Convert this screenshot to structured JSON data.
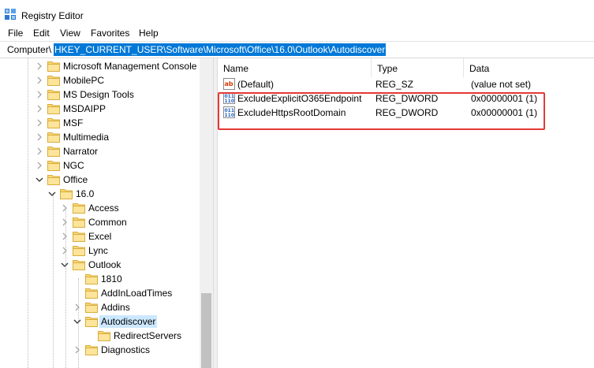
{
  "window": {
    "title": "Registry Editor"
  },
  "menu": [
    {
      "label": "File"
    },
    {
      "label": "Edit"
    },
    {
      "label": "View"
    },
    {
      "label": "Favorites"
    },
    {
      "label": "Help"
    }
  ],
  "address": {
    "prefix": "Computer\\",
    "path": "HKEY_CURRENT_USER\\Software\\Microsoft\\Office\\16.0\\Outlook\\Autodiscover"
  },
  "tree": [
    {
      "label": "Microsoft Management Console",
      "expander": "collapsed",
      "selected": false
    },
    {
      "label": "MobilePC",
      "expander": "collapsed",
      "selected": false
    },
    {
      "label": "MS Design Tools",
      "expander": "collapsed",
      "selected": false
    },
    {
      "label": "MSDAIPP",
      "expander": "collapsed",
      "selected": false
    },
    {
      "label": "MSF",
      "expander": "collapsed",
      "selected": false
    },
    {
      "label": "Multimedia",
      "expander": "collapsed",
      "selected": false
    },
    {
      "label": "Narrator",
      "expander": "collapsed",
      "selected": false
    },
    {
      "label": "NGC",
      "expander": "collapsed",
      "selected": false
    },
    {
      "label": "Office",
      "expander": "expanded",
      "selected": false
    },
    {
      "label": "16.0",
      "expander": "expanded",
      "selected": false
    },
    {
      "label": "Access",
      "expander": "collapsed",
      "selected": false
    },
    {
      "label": "Common",
      "expander": "collapsed",
      "selected": false
    },
    {
      "label": "Excel",
      "expander": "collapsed",
      "selected": false
    },
    {
      "label": "Lync",
      "expander": "collapsed",
      "selected": false
    },
    {
      "label": "Outlook",
      "expander": "expanded",
      "selected": false
    },
    {
      "label": "1810",
      "expander": "none",
      "selected": false
    },
    {
      "label": "AddInLoadTimes",
      "expander": "none",
      "selected": false
    },
    {
      "label": "Addins",
      "expander": "collapsed",
      "selected": false
    },
    {
      "label": "Autodiscover",
      "expander": "expanded",
      "selected": true
    },
    {
      "label": "RedirectServers",
      "expander": "none",
      "selected": false
    },
    {
      "label": "Diagnostics",
      "expander": "collapsed",
      "selected": false
    }
  ],
  "list": {
    "columns": [
      {
        "label": "Name"
      },
      {
        "label": "Type"
      },
      {
        "label": "Data"
      }
    ],
    "rows": [
      {
        "icon": "string-value-icon",
        "name": "(Default)",
        "type": "REG_SZ",
        "data": "(value not set)"
      },
      {
        "icon": "binary-value-icon",
        "name": "ExcludeExplicitO365Endpoint",
        "type": "REG_DWORD",
        "data": "0x00000001 (1)"
      },
      {
        "icon": "binary-value-icon",
        "name": "ExcludeHttpsRootDomain",
        "type": "REG_DWORD",
        "data": "0x00000001 (1)"
      }
    ]
  },
  "colors": {
    "address_highlight": "#0078d7",
    "tree_selection": "#cce8ff",
    "folder": "#f8d775",
    "annotation_box": "#e53935"
  }
}
